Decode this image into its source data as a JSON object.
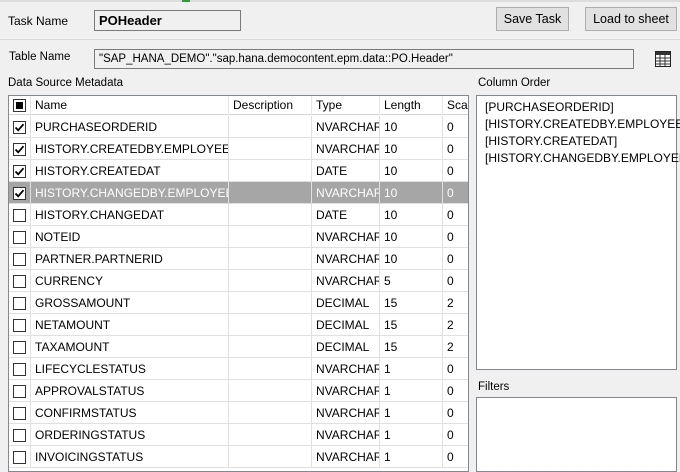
{
  "task": {
    "label": "Task Name",
    "value": "POHeader"
  },
  "buttons": {
    "save_task": "Save Task",
    "load_to_sheet": "Load to sheet"
  },
  "table": {
    "label": "Table Name",
    "value": "\"SAP_HANA_DEMO\".\"sap.hana.democontent.epm.data::PO.Header\"",
    "browse_icon": "table-browse-icon"
  },
  "metadata": {
    "section_label": "Data Source Metadata",
    "columns": [
      "Name",
      "Description",
      "Type",
      "Length",
      "Scal"
    ],
    "rows": [
      {
        "checked": true,
        "selected": false,
        "name": "PURCHASEORDERID",
        "description": "",
        "type": "NVARCHAR",
        "length": "10",
        "scale": "0"
      },
      {
        "checked": true,
        "selected": false,
        "name": "HISTORY.CREATEDBY.EMPLOYEEID",
        "description": "",
        "type": "NVARCHAR",
        "length": "10",
        "scale": "0"
      },
      {
        "checked": true,
        "selected": false,
        "name": "HISTORY.CREATEDAT",
        "description": "",
        "type": "DATE",
        "length": "10",
        "scale": "0"
      },
      {
        "checked": true,
        "selected": true,
        "name": "HISTORY.CHANGEDBY.EMPLOYEEID",
        "description": "",
        "type": "NVARCHAR",
        "length": "10",
        "scale": "0"
      },
      {
        "checked": false,
        "selected": false,
        "name": "HISTORY.CHANGEDAT",
        "description": "",
        "type": "DATE",
        "length": "10",
        "scale": "0"
      },
      {
        "checked": false,
        "selected": false,
        "name": "NOTEID",
        "description": "",
        "type": "NVARCHAR",
        "length": "10",
        "scale": "0"
      },
      {
        "checked": false,
        "selected": false,
        "name": "PARTNER.PARTNERID",
        "description": "",
        "type": "NVARCHAR",
        "length": "10",
        "scale": "0"
      },
      {
        "checked": false,
        "selected": false,
        "name": "CURRENCY",
        "description": "",
        "type": "NVARCHAR",
        "length": "5",
        "scale": "0"
      },
      {
        "checked": false,
        "selected": false,
        "name": "GROSSAMOUNT",
        "description": "",
        "type": "DECIMAL",
        "length": "15",
        "scale": "2"
      },
      {
        "checked": false,
        "selected": false,
        "name": "NETAMOUNT",
        "description": "",
        "type": "DECIMAL",
        "length": "15",
        "scale": "2"
      },
      {
        "checked": false,
        "selected": false,
        "name": "TAXAMOUNT",
        "description": "",
        "type": "DECIMAL",
        "length": "15",
        "scale": "2"
      },
      {
        "checked": false,
        "selected": false,
        "name": "LIFECYCLESTATUS",
        "description": "",
        "type": "NVARCHAR",
        "length": "1",
        "scale": "0"
      },
      {
        "checked": false,
        "selected": false,
        "name": "APPROVALSTATUS",
        "description": "",
        "type": "NVARCHAR",
        "length": "1",
        "scale": "0"
      },
      {
        "checked": false,
        "selected": false,
        "name": "CONFIRMSTATUS",
        "description": "",
        "type": "NVARCHAR",
        "length": "1",
        "scale": "0"
      },
      {
        "checked": false,
        "selected": false,
        "name": "ORDERINGSTATUS",
        "description": "",
        "type": "NVARCHAR",
        "length": "1",
        "scale": "0"
      },
      {
        "checked": false,
        "selected": false,
        "name": "INVOICINGSTATUS",
        "description": "",
        "type": "NVARCHAR",
        "length": "1",
        "scale": "0"
      }
    ]
  },
  "column_order": {
    "label": "Column Order",
    "items": [
      "[PURCHASEORDERID]",
      "[HISTORY.CREATEDBY.EMPLOYEEID]",
      "[HISTORY.CREATEDAT]",
      "[HISTORY.CHANGEDBY.EMPLOYEEID]"
    ]
  },
  "filters": {
    "label": "Filters"
  },
  "colors": {
    "window_bg": "#f0f0f0",
    "selected_row_bg": "#a6a6a6",
    "selected_row_text": "#ffffff",
    "accent_green": "#2e9e3c"
  }
}
